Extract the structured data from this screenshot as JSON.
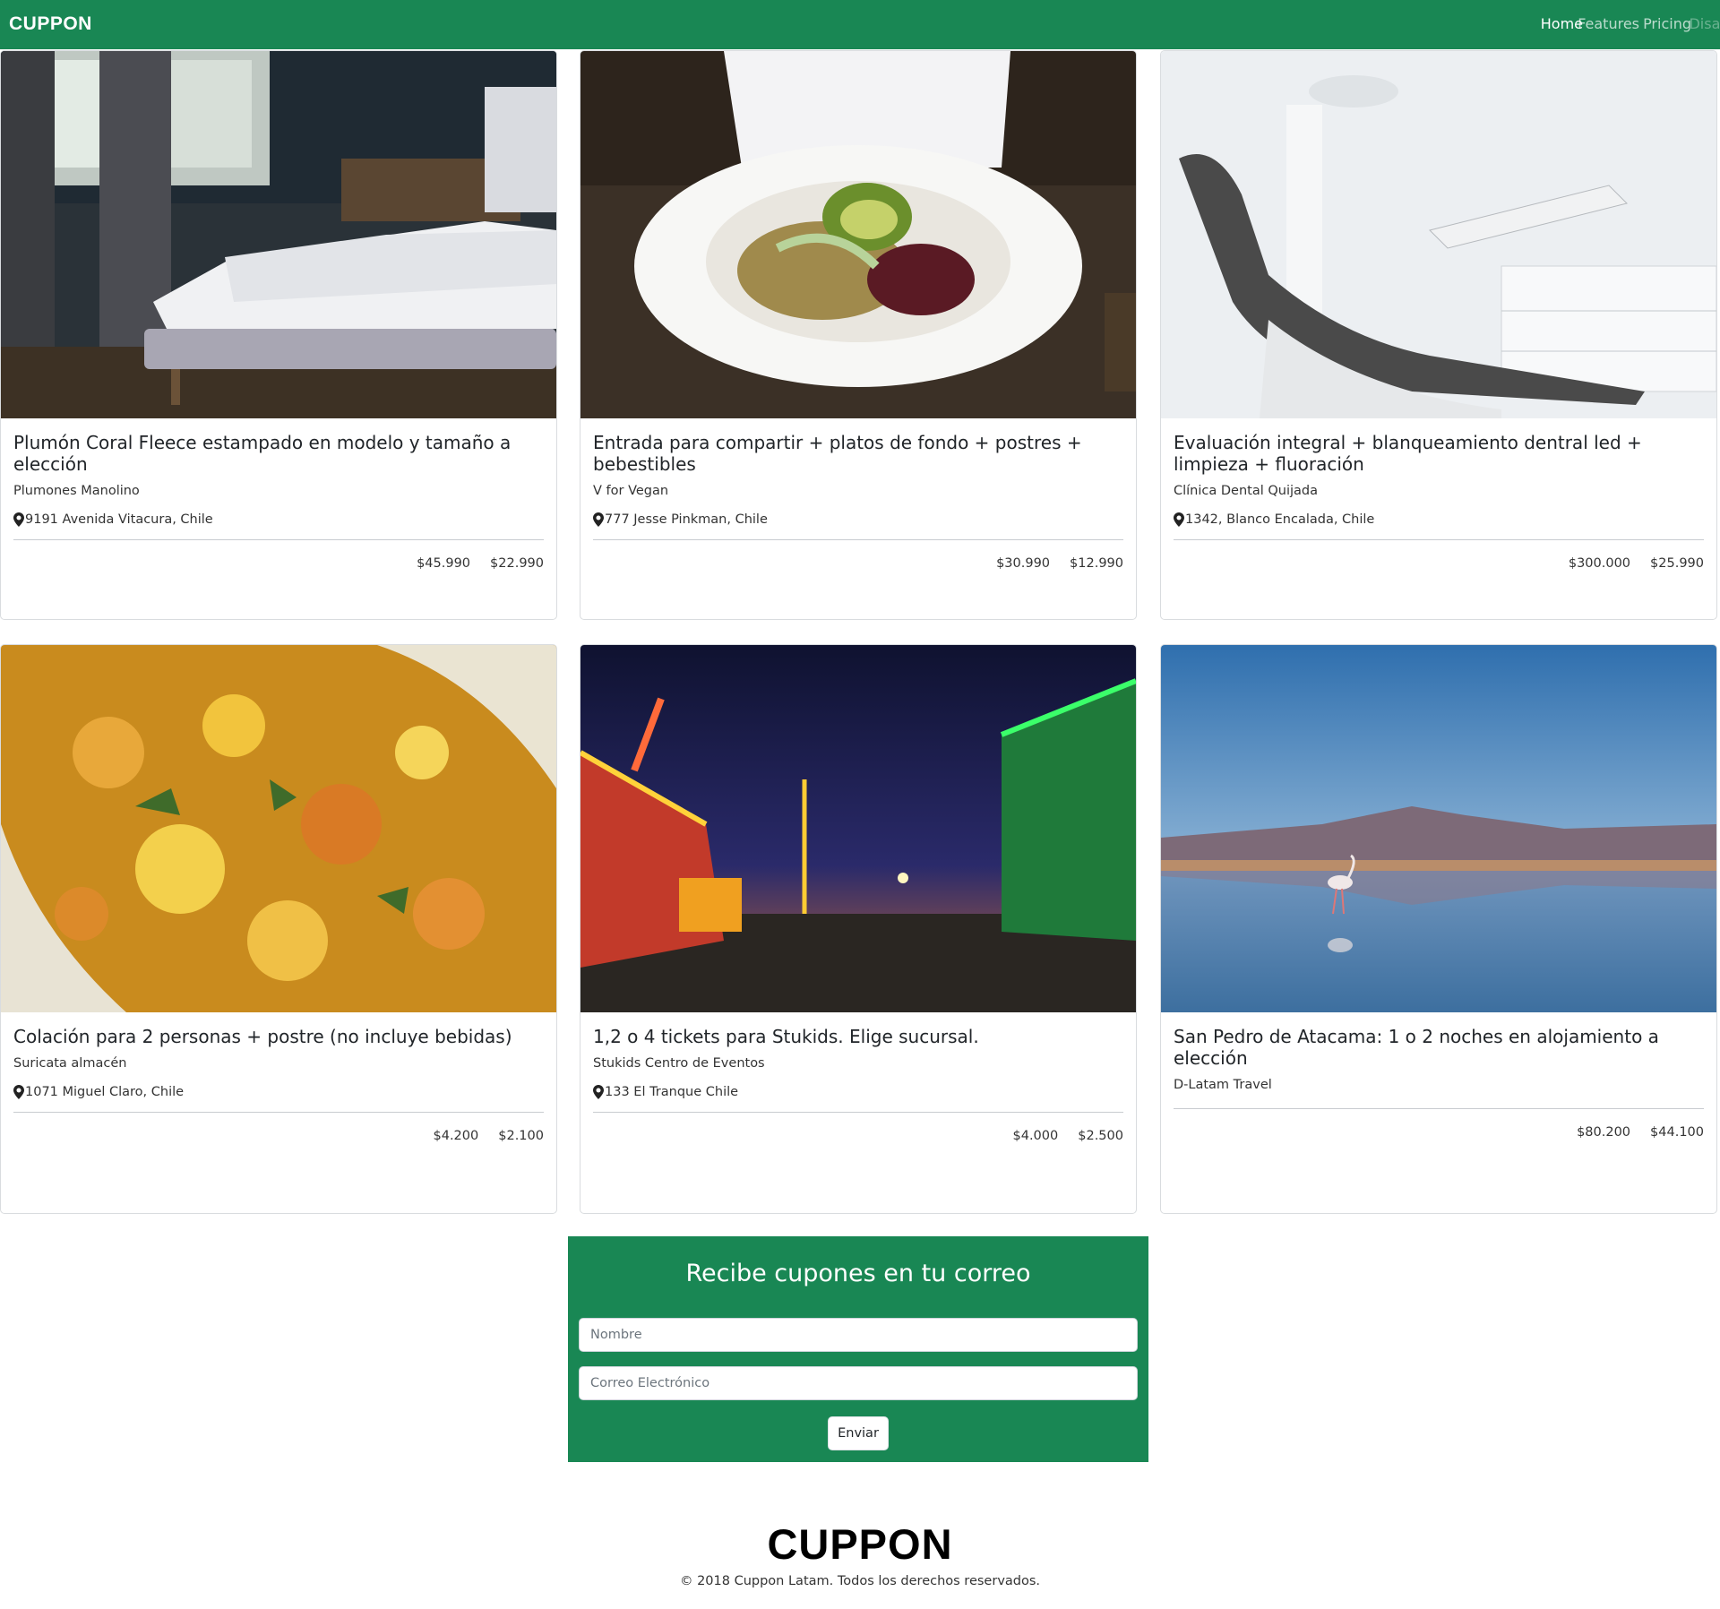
{
  "navbar": {
    "brand": "CUPPON",
    "links": [
      {
        "label": "Home"
      },
      {
        "label": "Features"
      },
      {
        "label": "Pricing"
      },
      {
        "label": "Disabled"
      }
    ]
  },
  "deals": [
    {
      "title": "Plumón Coral Fleece estampado en modelo y tamaño a elección",
      "company": "Plumones Manolino",
      "address": "9191 Avenida Vitacura, Chile",
      "price_original": "$45.990",
      "price_offer": "$22.990",
      "image": "bedroom-photo"
    },
    {
      "title": "Entrada para compartir + platos de fondo + postres + bebestibles",
      "company": "V for Vegan",
      "address": "777 Jesse Pinkman, Chile",
      "price_original": "$30.990",
      "price_offer": "$12.990",
      "image": "salad-plate-photo"
    },
    {
      "title": "Evaluación integral + blanqueamiento dentral led + limpieza + fluoración",
      "company": "Clínica Dental Quijada",
      "address": "1342, Blanco Encalada, Chile",
      "price_original": "$300.000",
      "price_offer": "$25.990",
      "image": "dental-chair-photo"
    },
    {
      "title": "Colación para 2 personas + postre (no incluye bebidas)",
      "company": "Suricata almacén",
      "address": "1071 Miguel Claro, Chile",
      "price_original": "$4.200",
      "price_offer": "$2.100",
      "image": "food-closeup-photo"
    },
    {
      "title": "1,2 o 4 tickets para Stukids. Elige sucursal.",
      "company": "Stukids Centro de Eventos",
      "address": "133 El Tranque Chile",
      "price_original": "$4.000",
      "price_offer": "$2.500",
      "image": "carnival-night-photo"
    },
    {
      "title": "San Pedro de Atacama: 1 o 2 noches en alojamiento a elección",
      "company": "D-Latam Travel",
      "address": "",
      "price_original": "$80.200",
      "price_offer": "$44.100",
      "image": "flamingo-lake-photo"
    }
  ],
  "subscribe": {
    "heading": "Recibe cupones en tu correo",
    "name_placeholder": "Nombre",
    "email_placeholder": "Correo Electrónico",
    "button_label": "Enviar"
  },
  "footer": {
    "logo": "CUPPON",
    "copyright": "© 2018 Cuppon Latam. Todos los derechos reservados."
  },
  "colors": {
    "brand_green": "#198754"
  }
}
